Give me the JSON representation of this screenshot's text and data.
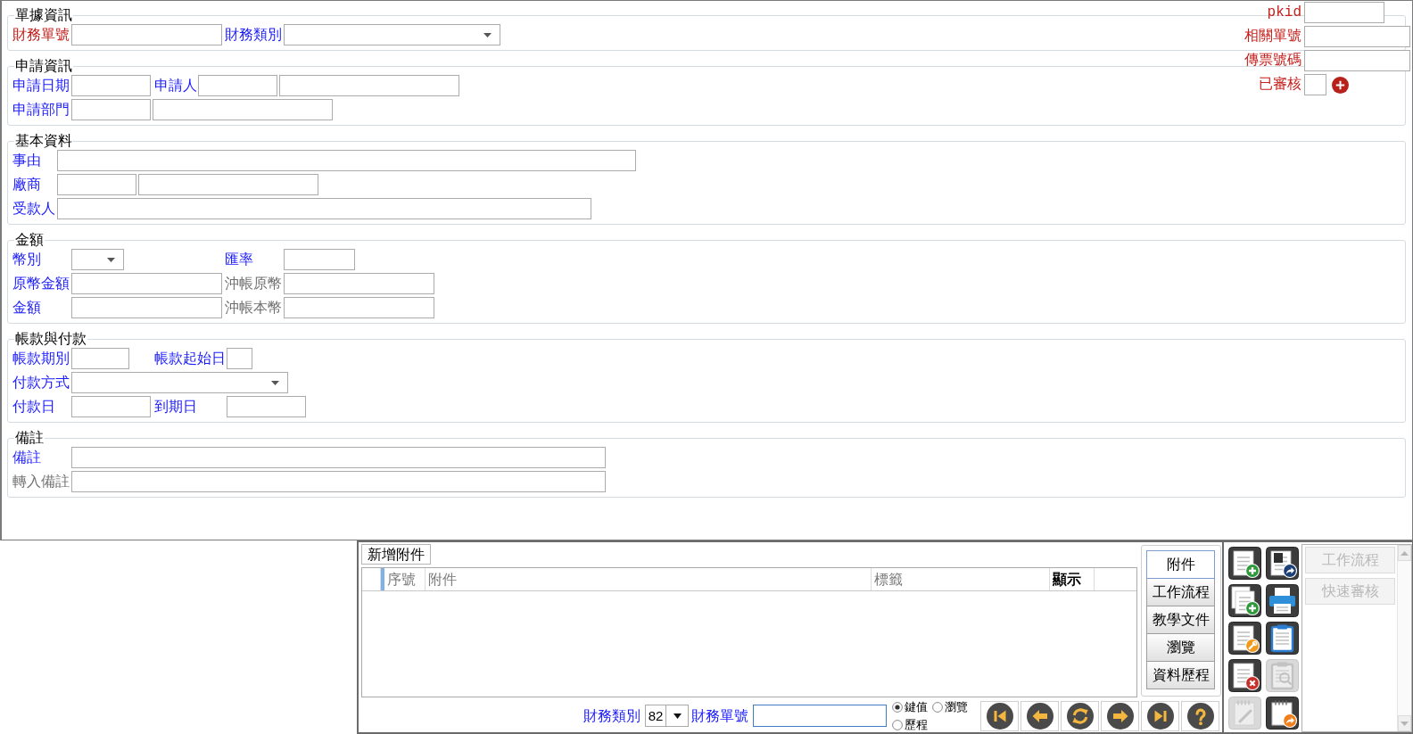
{
  "record_fields": [
    {
      "label": "pkid",
      "color": "#c4201c",
      "controls": [
        {
          "kind": "text"
        }
      ]
    },
    {
      "label": "相關單號",
      "color": "#c4201c",
      "controls": [
        {
          "kind": "text"
        }
      ]
    },
    {
      "label": "傳票號碼",
      "color": "#c4201c",
      "controls": [
        {
          "kind": "text"
        }
      ]
    },
    {
      "label": "已審核",
      "color": "#c4201c",
      "controls": [
        {
          "kind": "text"
        },
        {
          "kind": "add"
        }
      ]
    }
  ],
  "sections": [
    {
      "legend": "單據資訊",
      "rows": [
        [
          {
            "label": "財務單號",
            "color": "#c4201c",
            "controls": [
              {
                "kind": "text"
              }
            ]
          },
          {
            "label": "財務類別",
            "color": "#1a1aff",
            "controls": [
              {
                "kind": "select"
              }
            ]
          }
        ]
      ]
    },
    {
      "legend": "申請資訊",
      "rows": [
        [
          {
            "label": "申請日期",
            "color": "#1a1aff",
            "controls": [
              {
                "kind": "text"
              }
            ]
          },
          {
            "label": "申請人",
            "color": "#1a1aff",
            "controls": [
              {
                "kind": "text"
              },
              {
                "kind": "text"
              }
            ]
          }
        ],
        [
          {
            "label": "申請部門",
            "color": "#1a1aff",
            "controls": [
              {
                "kind": "text"
              },
              {
                "kind": "text"
              }
            ]
          }
        ]
      ]
    },
    {
      "legend": "基本資料",
      "rows": [
        [
          {
            "label": "事由",
            "color": "#1a1aff",
            "controls": [
              {
                "kind": "text"
              }
            ]
          }
        ],
        [
          {
            "label": "廠商",
            "color": "#1a1aff",
            "controls": [
              {
                "kind": "text"
              },
              {
                "kind": "text"
              }
            ]
          }
        ],
        [
          {
            "label": "受款人",
            "color": "#1a1aff",
            "controls": [
              {
                "kind": "text"
              }
            ]
          }
        ]
      ]
    },
    {
      "legend": "金額",
      "rows": [
        [
          {
            "label": "幣別",
            "color": "#1a1aff",
            "controls": [
              {
                "kind": "select"
              }
            ]
          },
          {
            "label": "匯率",
            "color": "#1a1aff",
            "controls": [
              {
                "kind": "text"
              }
            ]
          }
        ],
        [
          {
            "label": "原幣金額",
            "color": "#1a1aff",
            "controls": [
              {
                "kind": "text"
              }
            ]
          },
          {
            "label": "沖帳原幣",
            "color": "#707070",
            "controls": [
              {
                "kind": "text"
              }
            ]
          }
        ],
        [
          {
            "label": "金額",
            "color": "#1a1aff",
            "controls": [
              {
                "kind": "text"
              }
            ]
          },
          {
            "label": "沖帳本幣",
            "color": "#707070",
            "controls": [
              {
                "kind": "text"
              }
            ]
          }
        ]
      ]
    },
    {
      "legend": "帳款與付款",
      "rows": [
        [
          {
            "label": "帳款期別",
            "color": "#1a1aff",
            "controls": [
              {
                "kind": "text"
              }
            ]
          },
          {
            "label": "帳款起始日",
            "color": "#1a1aff",
            "controls": [
              {
                "kind": "text"
              }
            ]
          }
        ],
        [
          {
            "label": "付款方式",
            "color": "#1a1aff",
            "controls": [
              {
                "kind": "select"
              }
            ]
          }
        ],
        [
          {
            "label": "付款日",
            "color": "#1a1aff",
            "controls": [
              {
                "kind": "text"
              }
            ]
          },
          {
            "label": "到期日",
            "color": "#1a1aff",
            "controls": [
              {
                "kind": "text"
              }
            ]
          }
        ]
      ]
    },
    {
      "legend": "備註",
      "rows": [
        [
          {
            "label": "備註",
            "color": "#1a1aff",
            "controls": [
              {
                "kind": "text"
              }
            ]
          }
        ],
        [
          {
            "label": "轉入備註",
            "color": "#707070",
            "controls": [
              {
                "kind": "text"
              }
            ]
          }
        ]
      ]
    }
  ],
  "attachments": {
    "add_button": "新增附件",
    "columns": [
      {
        "label": "序號",
        "bold": false
      },
      {
        "label": "附件",
        "bold": false
      },
      {
        "label": "標籤",
        "bold": false
      },
      {
        "label": "顯示",
        "bold": true
      }
    ]
  },
  "side_tabs": [
    {
      "label": "附件",
      "selected": true
    },
    {
      "label": "工作流程",
      "selected": false
    },
    {
      "label": "教學文件",
      "selected": false
    },
    {
      "label": "瀏覽",
      "selected": false
    },
    {
      "label": "資料歷程",
      "selected": false
    }
  ],
  "navigator": {
    "category_label": "財務類別",
    "category_value": "82",
    "number_label": "財務單號",
    "modes": [
      {
        "label": "鍵值",
        "selected": true
      },
      {
        "label": "瀏覽",
        "selected": false
      },
      {
        "label": "歷程",
        "selected": false
      }
    ]
  },
  "toolbar": [
    {
      "disabled": false
    },
    {
      "disabled": false
    },
    {
      "disabled": false
    },
    {
      "disabled": false
    },
    {
      "disabled": false
    },
    {
      "disabled": false
    },
    {
      "disabled": false
    },
    {
      "disabled": true
    },
    {
      "disabled": true
    },
    {
      "disabled": false
    }
  ],
  "actions": [
    {
      "label": "工作流程",
      "disabled": true
    },
    {
      "label": "快速審核",
      "disabled": true
    }
  ]
}
